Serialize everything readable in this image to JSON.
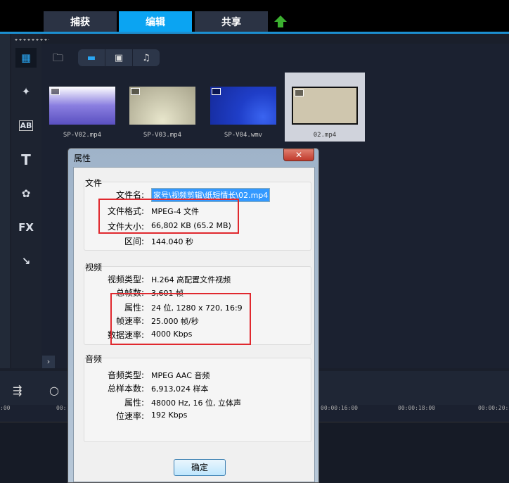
{
  "tabs": [
    {
      "label": "捕获"
    },
    {
      "label": "编辑"
    },
    {
      "label": "共享"
    }
  ],
  "sidebar_icons": [
    "media-icon",
    "instant-project-icon",
    "transition-icon",
    "title-icon",
    "graphics-icon",
    "filter-icon",
    "path-icon"
  ],
  "sidebar_labels": {
    "transition": "AB",
    "title": "T",
    "filter": "FX"
  },
  "thumbnails": [
    {
      "name": "SP-V02.mp4",
      "color": "#8a7ee0"
    },
    {
      "name": "SP-V03.mp4",
      "color": "#c8c4ac"
    },
    {
      "name": "SP-V04.wmv",
      "color": "#1f3ec8"
    },
    {
      "name": "02.mp4",
      "color": "#cfc6ae"
    }
  ],
  "timeline": {
    "ticks": [
      ":00",
      "00:",
      "00:00:16:00",
      "00:00:18:00",
      "00:00:20:"
    ]
  },
  "dialog": {
    "title": "属性",
    "close": "✕",
    "file": {
      "title": "文件",
      "rows": [
        {
          "label": "文件名:",
          "value": "家号\\视频剪辑\\纸短情长\\02.mp4"
        },
        {
          "label": "文件格式:",
          "value": "MPEG-4 文件"
        },
        {
          "label": "文件大小:",
          "value": "66,802 KB (65.2 MB)"
        },
        {
          "label": "区间:",
          "value": "144.040 秒"
        }
      ]
    },
    "video": {
      "title": "视频",
      "rows": [
        {
          "label": "视频类型:",
          "value": "H.264 高配置文件视频"
        },
        {
          "label": "总帧数:",
          "value": "3,601 帧"
        },
        {
          "label": "属性:",
          "value": "24 位, 1280 x 720, 16:9"
        },
        {
          "label": "帧速率:",
          "value": "25.000 帧/秒"
        },
        {
          "label": "数据速率:",
          "value": "4000 Kbps"
        }
      ]
    },
    "audio": {
      "title": "音频",
      "rows": [
        {
          "label": "音频类型:",
          "value": "MPEG AAC 音频"
        },
        {
          "label": "总样本数:",
          "value": "6,913,024 样本"
        },
        {
          "label": "属性:",
          "value": "48000 Hz, 16 位, 立体声"
        },
        {
          "label": "位速率:",
          "value": "192 Kbps"
        }
      ]
    },
    "ok": "确定"
  }
}
